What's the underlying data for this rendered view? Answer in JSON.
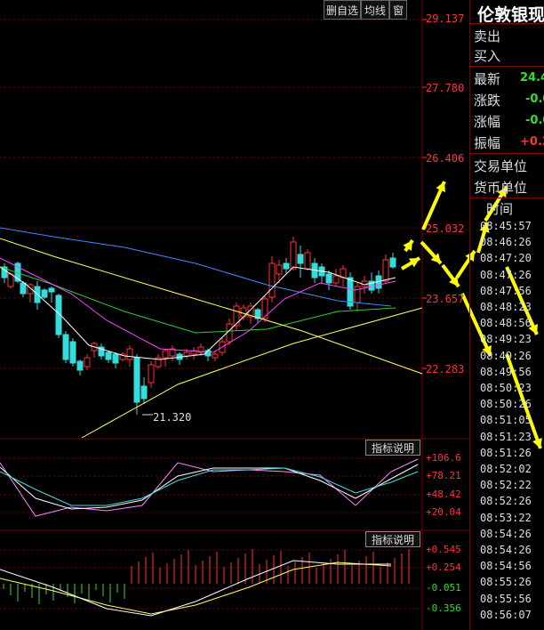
{
  "toolbar": {
    "delete_label": "删自选",
    "ma_label": "均线",
    "window_label": "窗"
  },
  "price_axis": [
    "29.137",
    "27.780",
    "26.406",
    "25.032",
    "23.657",
    "22.283"
  ],
  "low_marker": "21.320",
  "indicator1": {
    "button": "指标说明",
    "labels": [
      "+106.6",
      "+78.21",
      "+48.42",
      "+20.04"
    ]
  },
  "indicator2": {
    "button": "指标说明",
    "labels": [
      "+0.545",
      "+0.254",
      "-0.051",
      "-0.356"
    ]
  },
  "panel": {
    "title": "伦敦银现",
    "sell": "卖出",
    "buy": "买入",
    "latest_label": "最新",
    "latest_value": "24.4",
    "change_label": "涨跌",
    "change_value": "-0.0",
    "pct_label": "涨幅",
    "pct_value": "-0.0",
    "amp_label": "振幅",
    "amp_value": "+0.2",
    "trade_unit": "交易单位",
    "currency_unit": "货币单位",
    "time_header": "时间",
    "times": [
      "08:45:57",
      "08:46:26",
      "08:47:20",
      "08:47:26",
      "08:47:56",
      "08:48:23",
      "08:48:56",
      "08:49:23",
      "08:49:26",
      "08:49:56",
      "08:50:23",
      "08:50:26",
      "08:51:05",
      "08:51:23",
      "08:51:26",
      "08:52:02",
      "08:52:22",
      "08:52:26",
      "08:53:22",
      "08:54:26",
      "08:54:26",
      "08:54:56",
      "08:55:26",
      "08:55:56",
      "08:56:07"
    ]
  },
  "colors": {
    "up": "#ff3333",
    "down": "#33dddd",
    "annotation": "#ffff00",
    "grid": "#7a0000"
  }
}
